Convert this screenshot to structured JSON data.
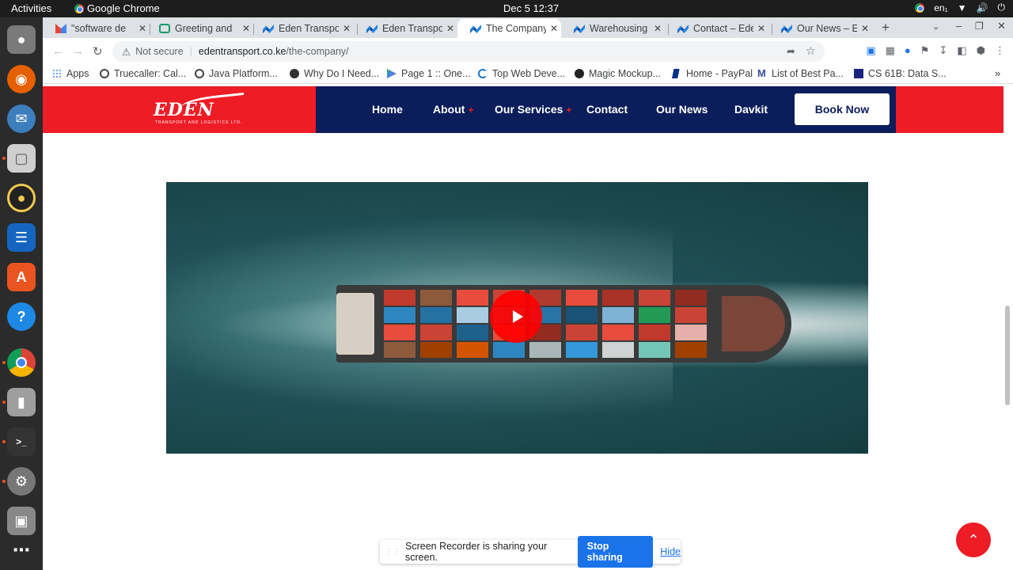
{
  "os": {
    "activities": "Activities",
    "app_name": "Google Chrome",
    "clock": "Dec 5  12:37",
    "keyboard_layout": "en₁"
  },
  "tabs": [
    {
      "title": "\"software de",
      "favicon": "gmail-icon"
    },
    {
      "title": "Greeting and",
      "favicon": "grammar-icon"
    },
    {
      "title": "Eden Transpo",
      "favicon": "eden-icon"
    },
    {
      "title": "Eden Transpo",
      "favicon": "eden-icon"
    },
    {
      "title": "The Company",
      "favicon": "eden-icon",
      "active": true
    },
    {
      "title": "Warehousing",
      "favicon": "eden-icon"
    },
    {
      "title": "Contact – Ede",
      "favicon": "eden-icon"
    },
    {
      "title": "Our News – E",
      "favicon": "eden-icon"
    }
  ],
  "address_bar": {
    "security": "Not secure",
    "domain": "edentransport.co.ke",
    "path": "/the-company/"
  },
  "bookmarks": [
    {
      "label": "Apps"
    },
    {
      "label": "Truecaller: Cal..."
    },
    {
      "label": "Java Platform..."
    },
    {
      "label": "Why Do I Need..."
    },
    {
      "label": "Page 1 :: One..."
    },
    {
      "label": "Top Web Deve..."
    },
    {
      "label": "Magic Mockup..."
    },
    {
      "label": "Home - PayPal"
    },
    {
      "label": "List of Best Pa..."
    },
    {
      "label": "CS 61B: Data S..."
    }
  ],
  "site": {
    "logo": "EDEN",
    "logo_tagline": "TRANSPORT AND LOGISTICS LTD.",
    "nav": [
      {
        "label": "Home",
        "has_submenu": false
      },
      {
        "label": "About",
        "has_submenu": true
      },
      {
        "label": "Our Services",
        "has_submenu": true
      },
      {
        "label": "Contact",
        "has_submenu": false
      },
      {
        "label": "Our News",
        "has_submenu": false
      },
      {
        "label": "Davkit",
        "has_submenu": false
      }
    ],
    "submenu_marker": "+",
    "book_now": "Book Now",
    "brand_red": "#ee1c25",
    "brand_navy": "#0b1d5b"
  },
  "screen_share": {
    "message": "Screen Recorder is sharing your screen.",
    "stop": "Stop sharing",
    "hide": "Hide"
  }
}
